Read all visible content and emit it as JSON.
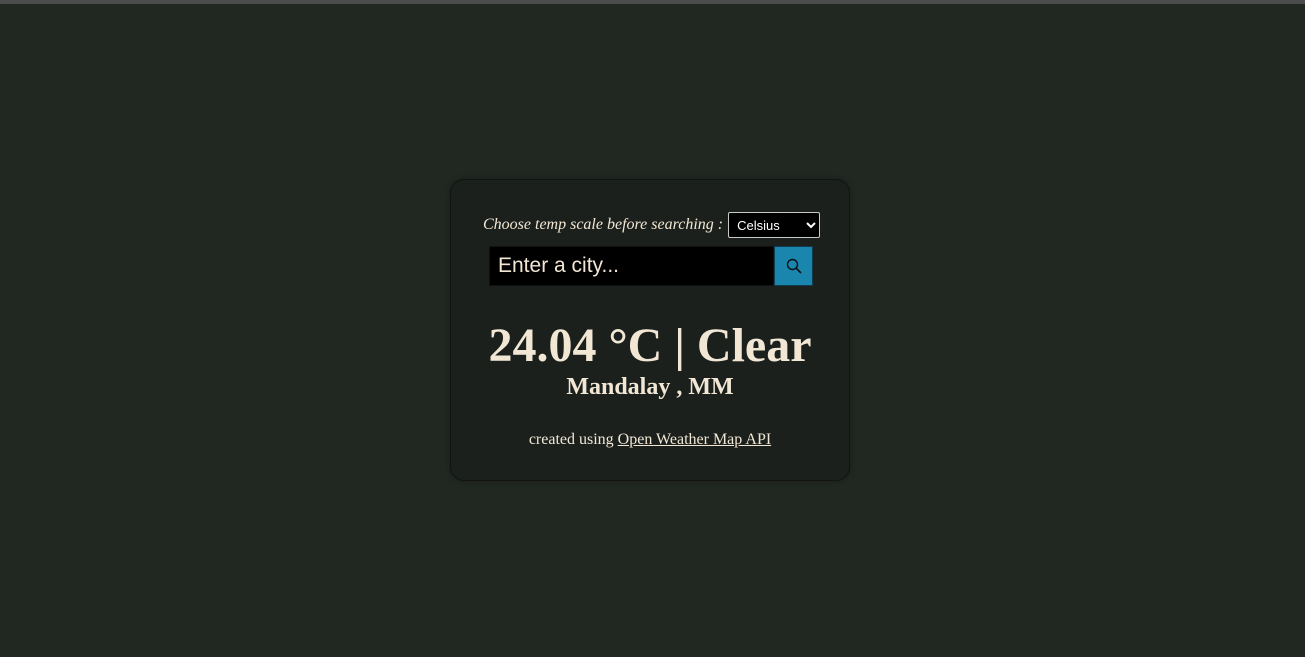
{
  "colors": {
    "page_background": "#212822",
    "card_background": "#1b201c",
    "text": "#f2e7d5",
    "search_button": "#1a86ad"
  },
  "scale": {
    "label": "Choose temp scale before searching :",
    "selected": "Celsius"
  },
  "search": {
    "placeholder": "Enter a city...",
    "button_icon": "search-icon"
  },
  "weather": {
    "summary": "24.04 °C | Clear",
    "location": "Mandalay , MM"
  },
  "credit": {
    "prefix": "created using ",
    "link_text": "Open Weather Map API"
  }
}
